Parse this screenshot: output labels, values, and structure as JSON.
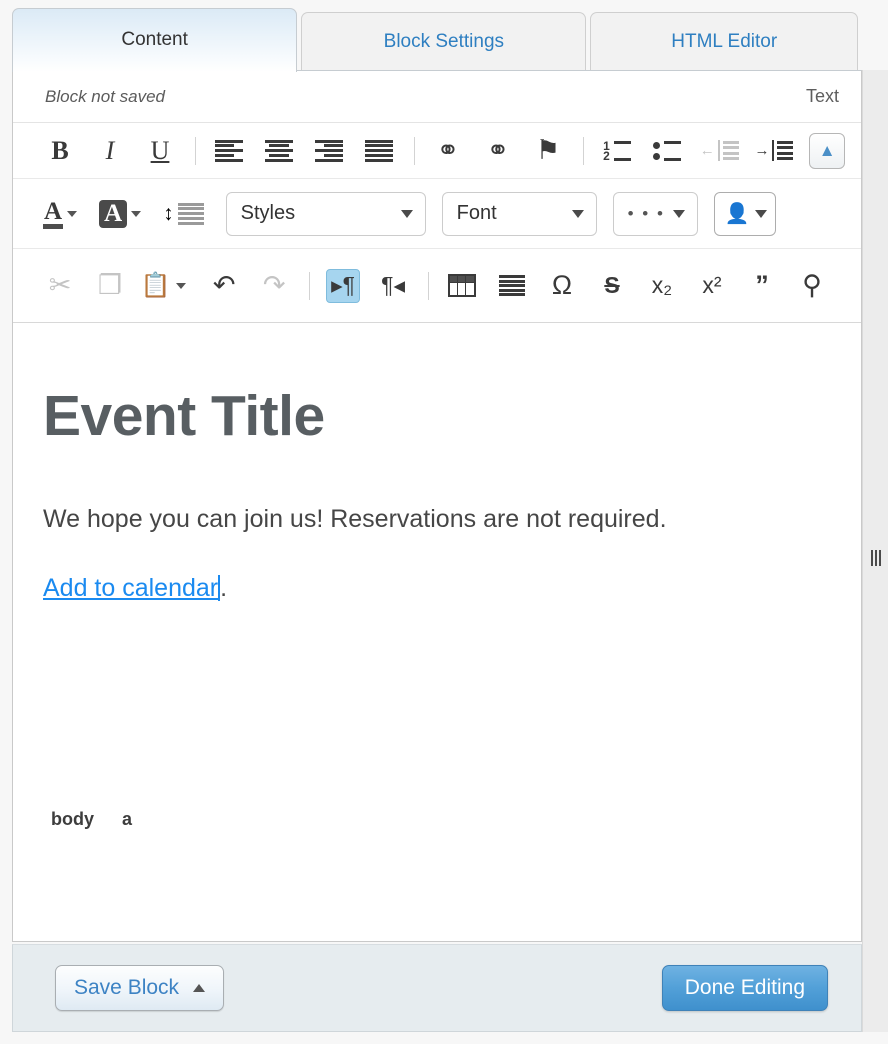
{
  "tabs": [
    {
      "label": "Content",
      "active": true
    },
    {
      "label": "Block Settings",
      "active": false
    },
    {
      "label": "HTML Editor",
      "active": false
    }
  ],
  "status": {
    "saved_state": "Block not saved",
    "mode_label": "Text"
  },
  "toolbar": {
    "row1": [
      {
        "name": "bold-icon",
        "glyph": "B"
      },
      {
        "name": "italic-icon",
        "glyph": "I"
      },
      {
        "name": "underline-icon",
        "glyph": "U"
      },
      {
        "name": "align-left-icon",
        "glyph": ""
      },
      {
        "name": "align-center-icon",
        "glyph": ""
      },
      {
        "name": "align-right-icon",
        "glyph": ""
      },
      {
        "name": "align-justify-icon",
        "glyph": ""
      },
      {
        "name": "link-icon",
        "glyph": "⚭"
      },
      {
        "name": "unlink-icon",
        "glyph": "⚭"
      },
      {
        "name": "anchor-flag-icon",
        "glyph": "⚑"
      },
      {
        "name": "numbered-list-icon",
        "glyph": ""
      },
      {
        "name": "bulleted-list-icon",
        "glyph": ""
      },
      {
        "name": "decrease-indent-icon",
        "glyph": ""
      },
      {
        "name": "increase-indent-icon",
        "glyph": ""
      }
    ],
    "collapse_toolbar_icon": "▲",
    "text_color_label": "A",
    "bg_color_label": "A",
    "line_height_icon": "↕",
    "styles_dropdown": "Styles",
    "font_dropdown": "Font",
    "more_dropdown": "• • •",
    "person_dropdown_icon": "person-icon",
    "row3": [
      {
        "name": "cut-icon",
        "glyph": "✂"
      },
      {
        "name": "copy-icon",
        "glyph": "❐"
      },
      {
        "name": "paste-icon",
        "glyph": "Ὄb"
      },
      {
        "name": "undo-icon",
        "glyph": "↶"
      },
      {
        "name": "redo-icon",
        "glyph": "↷"
      },
      {
        "name": "ltr-direction-icon",
        "glyph": "¶"
      },
      {
        "name": "rtl-direction-icon",
        "glyph": "¶"
      },
      {
        "name": "insert-table-icon",
        "glyph": ""
      },
      {
        "name": "horizontal-rule-icon",
        "glyph": ""
      },
      {
        "name": "special-character-icon",
        "glyph": "Ω"
      },
      {
        "name": "strikethrough-icon",
        "glyph": "S"
      },
      {
        "name": "subscript-icon",
        "glyph": "x₂"
      },
      {
        "name": "superscript-icon",
        "glyph": "x²"
      },
      {
        "name": "blockquote-icon",
        "glyph": "”"
      },
      {
        "name": "find-icon",
        "glyph": "⚲"
      }
    ]
  },
  "document": {
    "title": "Event Title",
    "paragraph": "We hope you can join us! Reservations are not required.",
    "link_text": "Add to calendar",
    "link_trailing": "."
  },
  "element_path": [
    "body",
    "a"
  ],
  "footer": {
    "save_block_label": "Save Block",
    "save_block_caret": "▲",
    "done_editing_label": "Done Editing"
  },
  "colors": {
    "accent_blue": "#2e7fc1",
    "link_blue": "#1a8af0",
    "title_gray": "#585e62",
    "footer_bg": "#e6ecef",
    "active_tool_bg": "#a6d5ef"
  }
}
